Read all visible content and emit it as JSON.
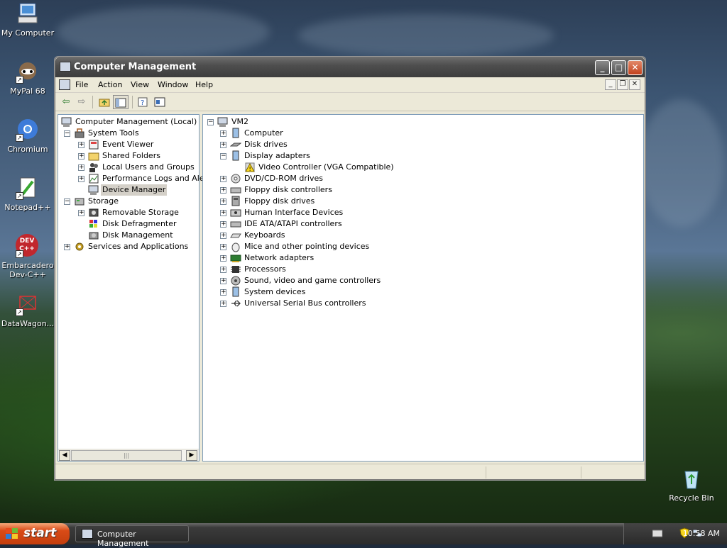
{
  "desktop": {
    "icons": [
      {
        "label": "My Computer"
      },
      {
        "label": "MyPal 68"
      },
      {
        "label": "Chromium"
      },
      {
        "label": "Notepad++"
      },
      {
        "label": "Embarcadero Dev-C++"
      },
      {
        "label": "DataWagon..."
      },
      {
        "label": "Recycle Bin"
      }
    ],
    "devcpp_badge": "DEV C++"
  },
  "window": {
    "title": "Computer Management",
    "menu": [
      "File",
      "Action",
      "View",
      "Window",
      "Help"
    ]
  },
  "tree": {
    "root": "Computer Management (Local)",
    "items": [
      "System Tools",
      "Event Viewer",
      "Shared Folders",
      "Local Users and Groups",
      "Performance Logs and Alerts",
      "Device Manager",
      "Storage",
      "Removable Storage",
      "Disk Defragmenter",
      "Disk Management",
      "Services and Applications"
    ],
    "selected": "Device Manager"
  },
  "devices": {
    "root": "VM2",
    "categories": [
      "Computer",
      "Disk drives",
      "Display adapters",
      "Video Controller (VGA Compatible)",
      "DVD/CD-ROM drives",
      "Floppy disk controllers",
      "Floppy disk drives",
      "Human Interface Devices",
      "IDE ATA/ATAPI controllers",
      "Keyboards",
      "Mice and other pointing devices",
      "Network adapters",
      "Processors",
      "Sound, video and game controllers",
      "System devices",
      "Universal Serial Bus controllers"
    ]
  },
  "taskbar": {
    "start_label": "start",
    "task_label": "Computer Management",
    "clock": "10:58 AM"
  },
  "colors": {
    "xp_blue": "#0a246a",
    "start_orange": "#d94b17",
    "warning_yellow": "#f7d51d"
  }
}
